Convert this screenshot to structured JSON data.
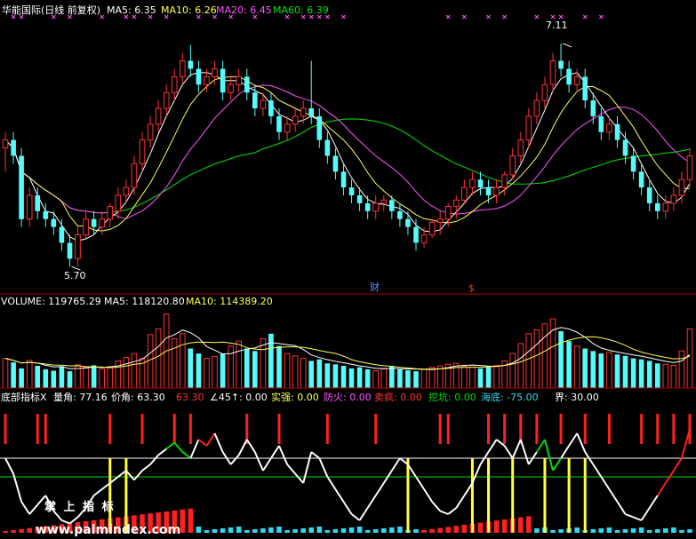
{
  "colors": {
    "background": "#000000",
    "up": "#FF3232",
    "down": "#54FCFC",
    "ma5": "#FFFFFF",
    "ma10": "#FFFF54",
    "ma20": "#FF54FF",
    "ma60": "#00E600",
    "panel_line": "#A00000",
    "marker": "#FF54FF",
    "ind_white": "#FFFFFF",
    "ind_green": "#00DC00",
    "ind_red": "#FF2020",
    "ind_yellow": "#FFFF40",
    "ind_cyan": "#30D8F0"
  },
  "price_header": {
    "title": "华能国际(日线 前复权)",
    "ma5": "MA5: 6.35",
    "ma10": "MA10: 6.26",
    "ma20": "MA20: 6.45",
    "ma60": "MA60: 6.39"
  },
  "volume_header": {
    "volume": "VOLUME: 119765.29",
    "ma5": "MA5: 118120.80",
    "ma10": "MA10: 114389.20"
  },
  "indicator_header": {
    "name": "底部指标X",
    "liangjiao": "量角: 77.16",
    "jiajiao": "价角: 63.30",
    "val3": "63.30",
    "angle": "∠45↑: 0.00",
    "shiqiang": "实强: 0.00",
    "fanghuo": "防火: 0.00",
    "maifeng": "卖疯: 0.00",
    "wakeng": "挖坑: 0.00",
    "haidi": "海底: -75.00",
    "jie": "界: 30.00"
  },
  "annotations": {
    "high_label": "7.11",
    "low_label": "5.70",
    "cai_label": "财",
    "s_label": "$"
  },
  "watermark": {
    "cn": "掌 上 指 标",
    "url": "www.palmindex.com"
  },
  "chart_data": [
    {
      "type": "candlestick",
      "title": "华能国际(日线 前复权)",
      "ylim": [
        5.6,
        7.25
      ],
      "highest": 7.11,
      "lowest": 5.7,
      "ohlc": [
        [
          6.45,
          6.55,
          6.3,
          6.5
        ],
        [
          6.5,
          6.55,
          6.35,
          6.4
        ],
        [
          6.4,
          6.45,
          5.95,
          6.0
        ],
        [
          6.0,
          6.2,
          5.95,
          6.15
        ],
        [
          6.15,
          6.2,
          6.0,
          6.05
        ],
        [
          6.05,
          6.1,
          5.95,
          6.0
        ],
        [
          6.0,
          6.05,
          5.9,
          5.95
        ],
        [
          5.95,
          6.0,
          5.8,
          5.85
        ],
        [
          5.85,
          5.9,
          5.7,
          5.75
        ],
        [
          5.75,
          5.95,
          5.7,
          5.9
        ],
        [
          5.9,
          6.05,
          5.88,
          6.0
        ],
        [
          6.0,
          6.05,
          5.9,
          5.95
        ],
        [
          5.95,
          6.05,
          5.9,
          6.0
        ],
        [
          6.0,
          6.1,
          5.95,
          6.08
        ],
        [
          6.05,
          6.2,
          6.0,
          6.15
        ],
        [
          6.15,
          6.25,
          6.1,
          6.2
        ],
        [
          6.2,
          6.4,
          6.15,
          6.35
        ],
        [
          6.35,
          6.55,
          6.3,
          6.5
        ],
        [
          6.5,
          6.65,
          6.45,
          6.6
        ],
        [
          6.6,
          6.75,
          6.55,
          6.7
        ],
        [
          6.7,
          6.85,
          6.65,
          6.8
        ],
        [
          6.8,
          6.95,
          6.75,
          6.9
        ],
        [
          6.9,
          7.05,
          6.85,
          7.0
        ],
        [
          7.0,
          7.1,
          6.9,
          6.95
        ],
        [
          6.95,
          7.0,
          6.8,
          6.85
        ],
        [
          6.85,
          6.95,
          6.8,
          6.9
        ],
        [
          6.9,
          7.0,
          6.85,
          6.95
        ],
        [
          6.95,
          7.0,
          6.75,
          6.8
        ],
        [
          6.8,
          6.9,
          6.75,
          6.85
        ],
        [
          6.85,
          6.95,
          6.8,
          6.9
        ],
        [
          6.9,
          6.95,
          6.75,
          6.8
        ],
        [
          6.8,
          6.85,
          6.65,
          6.7
        ],
        [
          6.7,
          6.8,
          6.65,
          6.75
        ],
        [
          6.75,
          6.8,
          6.6,
          6.65
        ],
        [
          6.65,
          6.7,
          6.5,
          6.55
        ],
        [
          6.55,
          6.65,
          6.5,
          6.6
        ],
        [
          6.6,
          6.7,
          6.55,
          6.65
        ],
        [
          6.65,
          6.75,
          6.6,
          6.7
        ],
        [
          6.7,
          7.0,
          6.6,
          6.65
        ],
        [
          6.65,
          6.7,
          6.45,
          6.5
        ],
        [
          6.5,
          6.55,
          6.35,
          6.4
        ],
        [
          6.4,
          6.45,
          6.25,
          6.3
        ],
        [
          6.3,
          6.35,
          6.15,
          6.2
        ],
        [
          6.2,
          6.25,
          6.1,
          6.15
        ],
        [
          6.15,
          6.2,
          6.05,
          6.1
        ],
        [
          6.1,
          6.15,
          6.0,
          6.05
        ],
        [
          6.05,
          6.15,
          6.0,
          6.1
        ],
        [
          6.1,
          6.15,
          6.05,
          6.12
        ],
        [
          6.12,
          6.15,
          6.0,
          6.05
        ],
        [
          6.05,
          6.1,
          5.95,
          6.0
        ],
        [
          6.0,
          6.05,
          5.9,
          5.95
        ],
        [
          5.95,
          6.0,
          5.8,
          5.85
        ],
        [
          5.85,
          5.95,
          5.82,
          5.9
        ],
        [
          5.9,
          6.0,
          5.88,
          5.98
        ],
        [
          5.98,
          6.05,
          5.9,
          6.0
        ],
        [
          6.0,
          6.1,
          5.95,
          6.08
        ],
        [
          6.08,
          6.15,
          6.0,
          6.12
        ],
        [
          6.12,
          6.25,
          6.1,
          6.2
        ],
        [
          6.2,
          6.3,
          6.15,
          6.25
        ],
        [
          6.25,
          6.3,
          6.15,
          6.2
        ],
        [
          6.2,
          6.25,
          6.1,
          6.15
        ],
        [
          6.15,
          6.25,
          6.1,
          6.2
        ],
        [
          6.2,
          6.3,
          6.15,
          6.28
        ],
        [
          6.28,
          6.45,
          6.25,
          6.4
        ],
        [
          6.4,
          6.55,
          6.35,
          6.5
        ],
        [
          6.5,
          6.7,
          6.45,
          6.65
        ],
        [
          6.65,
          6.8,
          6.6,
          6.75
        ],
        [
          6.75,
          6.9,
          6.7,
          6.85
        ],
        [
          6.85,
          7.05,
          6.8,
          7.0
        ],
        [
          7.0,
          7.11,
          6.9,
          6.95
        ],
        [
          6.95,
          7.0,
          6.8,
          6.85
        ],
        [
          6.85,
          6.95,
          6.8,
          6.9
        ],
        [
          6.9,
          6.95,
          6.7,
          6.75
        ],
        [
          6.75,
          6.8,
          6.6,
          6.65
        ],
        [
          6.65,
          6.7,
          6.5,
          6.55
        ],
        [
          6.55,
          6.65,
          6.5,
          6.6
        ],
        [
          6.6,
          6.65,
          6.45,
          6.5
        ],
        [
          6.5,
          6.55,
          6.35,
          6.4
        ],
        [
          6.4,
          6.45,
          6.25,
          6.3
        ],
        [
          6.3,
          6.35,
          6.15,
          6.2
        ],
        [
          6.2,
          6.25,
          6.05,
          6.1
        ],
        [
          6.1,
          6.15,
          6.0,
          6.05
        ],
        [
          6.05,
          6.15,
          6.0,
          6.1
        ],
        [
          6.1,
          6.2,
          6.05,
          6.15
        ],
        [
          6.15,
          6.3,
          6.1,
          6.25
        ],
        [
          6.25,
          6.45,
          6.2,
          6.4
        ]
      ]
    },
    {
      "type": "bar",
      "title": "VOLUME",
      "ylim": [
        0,
        160000
      ],
      "values": [
        60000,
        52000,
        40000,
        56000,
        45000,
        38000,
        35000,
        44000,
        34000,
        47000,
        42000,
        46000,
        39000,
        42000,
        55000,
        62000,
        70000,
        60000,
        108000,
        120000,
        150000,
        100000,
        110000,
        80000,
        70000,
        60000,
        64000,
        70000,
        85000,
        95000,
        80000,
        75000,
        100000,
        110000,
        85000,
        70000,
        65000,
        60000,
        55000,
        58000,
        50000,
        48000,
        45000,
        40000,
        42000,
        38000,
        35000,
        40000,
        44000,
        38000,
        36000,
        34000,
        38000,
        42000,
        45000,
        48000,
        50000,
        44000,
        46000,
        40000,
        42000,
        46000,
        55000,
        70000,
        90000,
        110000,
        118000,
        130000,
        140000,
        115000,
        95000,
        85000,
        80000,
        75000,
        70000,
        72000,
        68000,
        65000,
        60000,
        58000,
        55000,
        50000,
        48000,
        46000,
        75000,
        119765
      ]
    },
    {
      "type": "line",
      "title": "底部指标X",
      "ylim": [
        -90,
        110
      ],
      "series": [
        {
          "name": "量角",
          "values": [
            30,
            5,
            -40,
            -60,
            -45,
            -30,
            -55,
            -70,
            -75,
            -65,
            -50,
            -30,
            -20,
            -10,
            0,
            10,
            -5,
            10,
            20,
            35,
            45,
            55,
            40,
            30,
            60,
            50,
            70,
            40,
            20,
            35,
            60,
            40,
            10,
            30,
            50,
            20,
            5,
            -10,
            40,
            30,
            0,
            -20,
            -40,
            -60,
            -70,
            -50,
            -30,
            -10,
            10,
            30,
            20,
            0,
            -20,
            -40,
            -55,
            -60,
            -50,
            -30,
            -10,
            20,
            40,
            60,
            50,
            30,
            60,
            20,
            40,
            60,
            10,
            30,
            50,
            70,
            40,
            20,
            0,
            -20,
            -40,
            -60,
            -65,
            -70,
            -50,
            -30,
            -10,
            10,
            30,
            77.16
          ]
        }
      ]
    }
  ]
}
